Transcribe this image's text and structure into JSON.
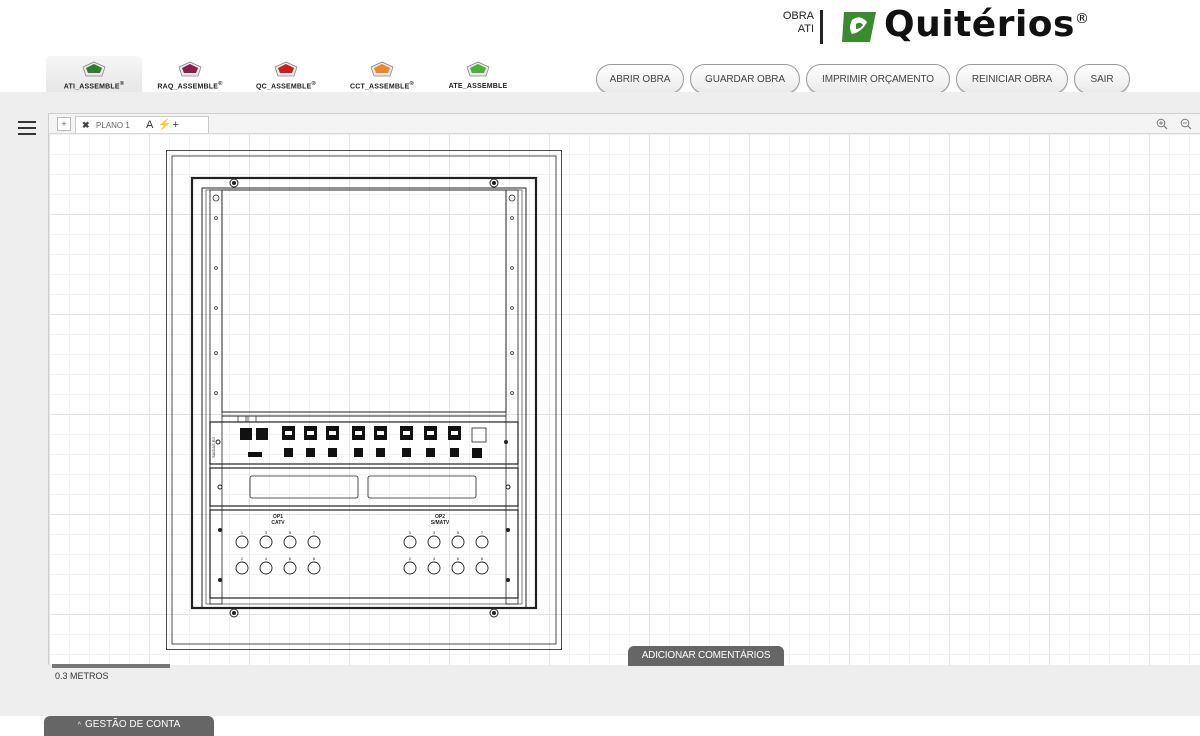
{
  "header": {
    "obra_label": "OBRA",
    "obra_value": "ATI",
    "brand_name": "Quitérios",
    "brand_mark": "®",
    "brand_color": "#3a8a2e"
  },
  "product_tabs": [
    {
      "label": "ATI_ASSEMBLE",
      "mark": "®",
      "color": "#2f7d2f",
      "active": true
    },
    {
      "label": "RAQ_ASSEMBLE",
      "mark": "®",
      "color": "#8a1f4f"
    },
    {
      "label": "QC_ASSEMBLE",
      "mark": "®",
      "color": "#c81e1e"
    },
    {
      "label": "CCT_ASSEMBLE",
      "mark": "®",
      "color": "#e8892b"
    },
    {
      "label": "ATE_ASSEMBLE",
      "mark": "",
      "color": "#4caf3a"
    }
  ],
  "actions": {
    "open": "ABRIR OBRA",
    "save": "GUARDAR OBRA",
    "print": "IMPRIMIR ORÇAMENTO",
    "restart": "REINICIAR OBRA",
    "exit": "SAIR"
  },
  "plan": {
    "tab_add": "+",
    "tab_close": "✖",
    "tab_name": "PLANO 1",
    "tab_tools": "A ⚡+",
    "comment_button": "ADICIONAR COMENTÁRIOS",
    "scale_label": "0.3 METROS"
  },
  "cabinet": {
    "rj_label": "SAIDAS RJ",
    "opt1_title": "OP1",
    "opt1_sub": "CATV",
    "opt2_title": "OP2",
    "opt2_sub": "S/MATV",
    "port_numbers_top": [
      "1",
      "3",
      "5",
      "7"
    ],
    "port_numbers_bottom": [
      "2",
      "4",
      "6",
      "8"
    ]
  },
  "account": {
    "label": "GESTÃO DE CONTA",
    "caret": "^"
  }
}
